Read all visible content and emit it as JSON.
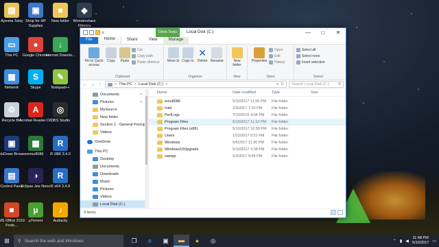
{
  "desktop": {
    "icons": [
      {
        "label": "Ayesha Tariq",
        "color": "#e8c35a",
        "glyph": "▤"
      },
      {
        "label": "Shop for HP Supplies",
        "color": "#3b78c9",
        "glyph": "▣"
      },
      {
        "label": "New folder",
        "color": "#f1c659",
        "glyph": "■"
      },
      {
        "label": "Wondershare Filmora",
        "color": "#2c3e50",
        "glyph": "◆"
      },
      {
        "label": "This PC",
        "color": "#4aa0e6",
        "glyph": "▭"
      },
      {
        "label": "Google Chrome",
        "color": "#db4437",
        "glyph": "●"
      },
      {
        "label": "Internet Downlo...",
        "color": "#3aa757",
        "glyph": "↓"
      },
      {
        "label": "Network",
        "color": "#3e8de0",
        "glyph": "▦"
      },
      {
        "label": "Skype",
        "color": "#00aff0",
        "glyph": "S"
      },
      {
        "label": "Notepad++",
        "color": "#8dc63f",
        "glyph": "✎"
      },
      {
        "label": "Recycle Bin",
        "color": "#c9d1d9",
        "glyph": "♲"
      },
      {
        "label": "Acrobat Reader DC",
        "color": "#d9261c",
        "glyph": "A"
      },
      {
        "label": "OBS Studio",
        "color": "#2b2b2b",
        "glyph": "◎"
      },
      {
        "label": "LockDown Browser",
        "color": "#1d3c78",
        "glyph": "▣"
      },
      {
        "label": "emu8086",
        "color": "#2a7a3a",
        "glyph": "▩"
      },
      {
        "label": "R i386 3.4.0",
        "color": "#276dc2",
        "glyph": "R"
      },
      {
        "label": "Control Panel",
        "color": "#3a78c9",
        "glyph": "▤"
      },
      {
        "label": "Eclipse Jee Neon",
        "color": "#2c2255",
        "glyph": "◑"
      },
      {
        "label": "R x64 3.4.0",
        "color": "#276dc2",
        "glyph": "R"
      },
      {
        "label": "MS Office 2010 Profe...",
        "color": "#d24726",
        "glyph": "■"
      },
      {
        "label": "µTorrent",
        "color": "#48a032",
        "glyph": "µ"
      },
      {
        "label": "Audacity",
        "color": "#f2a900",
        "glyph": "♪"
      }
    ]
  },
  "window": {
    "title": "Local Disk (C:)",
    "context_tab": "Drive Tools",
    "quick_access_extra": "∨",
    "controls": {
      "minimize": "—",
      "maximize": "□",
      "close": "✕"
    },
    "tabs": [
      "File",
      "Home",
      "Share",
      "View",
      "Manage"
    ],
    "ribbon": {
      "clipboard": {
        "label": "Clipboard",
        "pin": "Pin to Quick access",
        "copy": "Copy",
        "paste": "Paste",
        "cut": "Cut",
        "copy_path": "Copy path",
        "paste_shortcut": "Paste shortcut"
      },
      "organize": {
        "label": "Organize",
        "move": "Move to",
        "copy": "Copy to",
        "delete": "Delete",
        "rename": "Rename"
      },
      "new": {
        "label": "New",
        "new_folder": "New folder"
      },
      "open": {
        "label": "Open",
        "properties": "Properties",
        "open": "Open",
        "edit": "Edit",
        "history": "History"
      },
      "select": {
        "label": "Select",
        "all": "Select all",
        "none": "Select none",
        "invert": "Invert selection"
      }
    },
    "address": {
      "back": "←",
      "forward": "→",
      "up": "↑",
      "path": [
        "This PC",
        "Local Disk (C:)"
      ],
      "separator": ">",
      "dropdown": "∨",
      "refresh": "↻",
      "search_placeholder": "Search Local Disk (C:)"
    },
    "nav": [
      {
        "label": "Documents",
        "icon": "docs",
        "pinned": true,
        "indent": 2
      },
      {
        "label": "Pictures",
        "icon": "pics",
        "pinned": true,
        "indent": 2
      },
      {
        "label": "MySource",
        "icon": "folder",
        "pinned": false,
        "indent": 2
      },
      {
        "label": "New folder",
        "icon": "folder",
        "pinned": false,
        "indent": 2
      },
      {
        "label": "Section 1 - General Principle",
        "icon": "folder",
        "pinned": false,
        "indent": 2
      },
      {
        "label": "Videos",
        "icon": "folder",
        "pinned": false,
        "indent": 2
      },
      {
        "label": "OneDrive",
        "icon": "onedrive",
        "pinned": false,
        "indent": 1
      },
      {
        "label": "This PC",
        "icon": "pc",
        "pinned": false,
        "indent": 1
      },
      {
        "label": "Desktop",
        "icon": "blue",
        "pinned": false,
        "indent": 2
      },
      {
        "label": "Documents",
        "icon": "docs",
        "pinned": false,
        "indent": 2
      },
      {
        "label": "Downloads",
        "icon": "blue",
        "pinned": false,
        "indent": 2
      },
      {
        "label": "Music",
        "icon": "blue",
        "pinned": false,
        "indent": 2
      },
      {
        "label": "Pictures",
        "icon": "pics",
        "pinned": false,
        "indent": 2
      },
      {
        "label": "Videos",
        "icon": "blue",
        "pinned": false,
        "indent": 2
      },
      {
        "label": "Local Disk (C:)",
        "icon": "disk",
        "pinned": false,
        "indent": 2,
        "selected": true
      }
    ],
    "columns": {
      "name": "Name",
      "date": "Date modified",
      "type": "Type",
      "size": "Size"
    },
    "files": [
      {
        "name": "emu8086",
        "date": "5/10/2017 11:05 PM",
        "type": "File folder"
      },
      {
        "name": "Intel",
        "date": "2/3/2017 7:32 PM",
        "type": "File folder"
      },
      {
        "name": "PerfLogs",
        "date": "7/10/2015 4:04 PM",
        "type": "File folder"
      },
      {
        "name": "Program Files",
        "date": "5/10/2017 11:12 PM",
        "type": "File folder",
        "hover": true
      },
      {
        "name": "Program Files (x86)",
        "date": "5/10/2017 10:58 PM",
        "type": "File folder"
      },
      {
        "name": "Users",
        "date": "1/23/2017 9:51 PM",
        "type": "File folder"
      },
      {
        "name": "Windows",
        "date": "5/6/2017 11:30 PM",
        "type": "File folder"
      },
      {
        "name": "Windows10Upgrade",
        "date": "5/10/2017 4:38 PM",
        "type": "File folder"
      },
      {
        "name": "xampp",
        "date": "5/2/2017 9:46 PM",
        "type": "File folder"
      }
    ],
    "status": "9 items"
  },
  "taskbar": {
    "search_placeholder": "Search the web and Windows",
    "apps": [
      "task-view",
      "edge",
      "store",
      "file-explorer",
      "chrome",
      "obs"
    ],
    "active_app": "file-explorer",
    "time": "11:48 PM",
    "date": "5/10/2017"
  }
}
